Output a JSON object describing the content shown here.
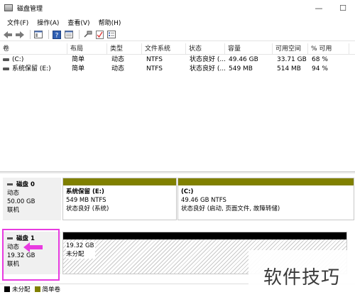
{
  "window": {
    "title": "磁盘管理",
    "minimize": "—",
    "maximize": "☐"
  },
  "menu": [
    "文件(F)",
    "操作(A)",
    "查看(V)",
    "帮助(H)"
  ],
  "volume_table": {
    "headers": [
      "卷",
      "布局",
      "类型",
      "文件系统",
      "状态",
      "容量",
      "可用空间",
      "% 可用"
    ],
    "rows": [
      [
        "(C:)",
        "简单",
        "动态",
        "NTFS",
        "状态良好 (...",
        "49.46 GB",
        "33.71 GB",
        "68 %"
      ],
      [
        "系统保留 (E:)",
        "简单",
        "动态",
        "NTFS",
        "状态良好 (...",
        "549 MB",
        "514 MB",
        "94 %"
      ]
    ]
  },
  "disks": [
    {
      "name": "磁盘 0",
      "type": "动态",
      "size": "50.00 GB",
      "status": "联机",
      "partitions": [
        {
          "title": "系统保留  (E:)",
          "line2": "549 MB NTFS",
          "line3": "状态良好 (系统)",
          "bar_color": "#808000"
        },
        {
          "title": "(C:)",
          "line2": "49.46 GB NTFS",
          "line3": "状态良好 (启动, 页面文件, 故障转储)",
          "bar_color": "#808000"
        }
      ]
    },
    {
      "name": "磁盘 1",
      "type": "动态",
      "size": "19.32 GB",
      "status": "联机",
      "partitions": [
        {
          "title": "19.32 GB",
          "line2": "未分配",
          "bar_color": "#000000"
        }
      ]
    }
  ],
  "legend": [
    {
      "label": "未分配",
      "color": "#000000"
    },
    {
      "label": "简单卷",
      "color": "#808000"
    }
  ],
  "annotation": {
    "highlight_color": "#e83be0"
  },
  "watermark": "软件技巧"
}
